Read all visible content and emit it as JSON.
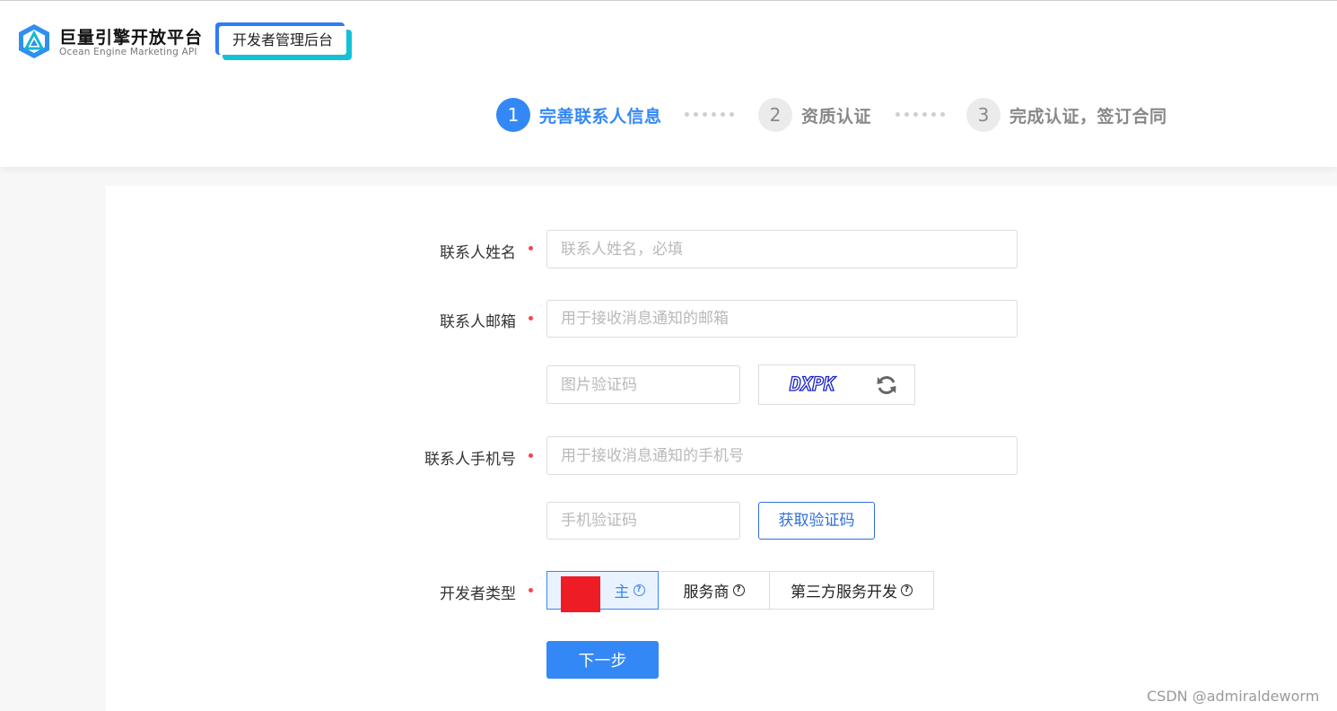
{
  "header": {
    "logo_title": "巨量引擎开放平台",
    "logo_subtitle": "Ocean Engine Marketing API",
    "badge": "开发者管理后台"
  },
  "steps": [
    {
      "num": "1",
      "label": "完善联系人信息",
      "state": "active"
    },
    {
      "num": "2",
      "label": "资质认证",
      "state": "inactive"
    },
    {
      "num": "3",
      "label": "完成认证，签订合同",
      "state": "inactive"
    }
  ],
  "form": {
    "name_label": "联系人姓名",
    "name_placeholder": "联系人姓名，必填",
    "email_label": "联系人邮箱",
    "email_placeholder": "用于接收消息通知的邮箱",
    "image_code_placeholder": "图片验证码",
    "captcha_text": "DXPK",
    "phone_label": "联系人手机号",
    "phone_placeholder": "用于接收消息通知的手机号",
    "sms_code_placeholder": "手机验证码",
    "get_code_label": "获取验证码",
    "type_label": "开发者类型",
    "type_options": [
      "主",
      "服务商",
      "第三方服务开发"
    ],
    "selected_type_index": 0,
    "next_label": "下一步"
  },
  "colors": {
    "primary": "#3388f5",
    "required": "#f0494c",
    "redaction": "#ee1c25"
  },
  "watermark": "CSDN @admiraldeworm"
}
